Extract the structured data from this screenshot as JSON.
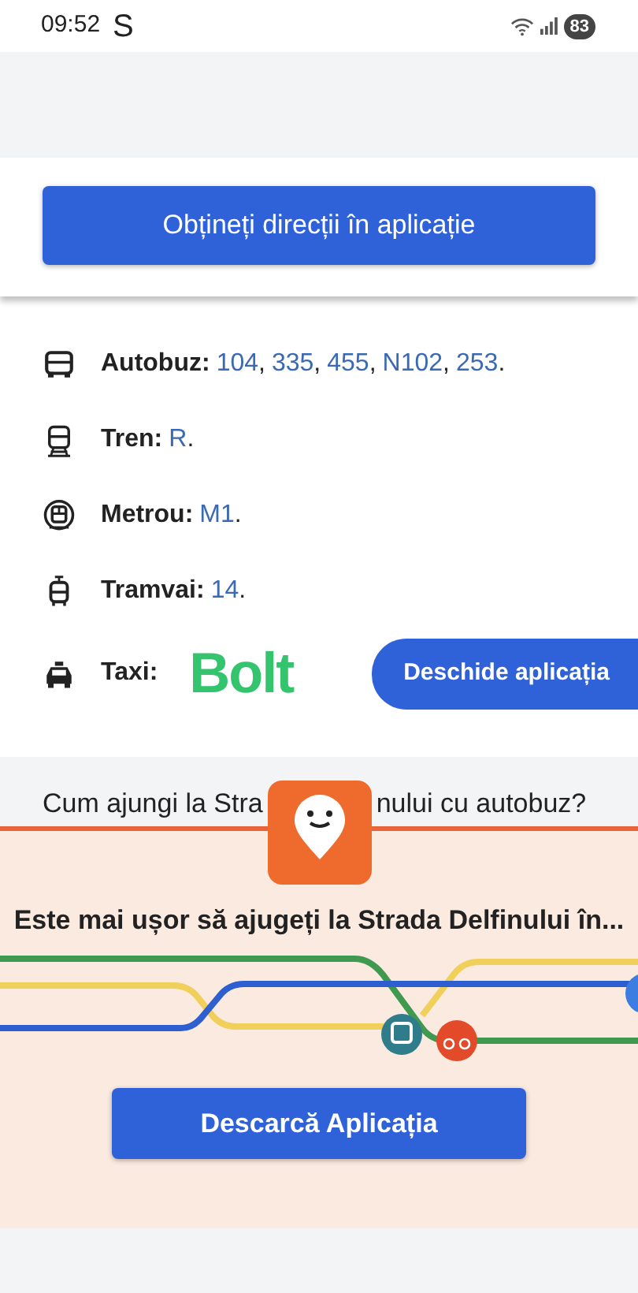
{
  "status_bar": {
    "time": "09:52",
    "notification": "S",
    "battery": "83"
  },
  "header": {
    "button": "Obțineți direcții în aplicație"
  },
  "transit": [
    {
      "kind": "bus",
      "label": "Autobuz:",
      "lines": [
        {
          "line": "104",
          "punct": ","
        },
        {
          "line": "335",
          "punct": ","
        },
        {
          "line": "455",
          "punct": ","
        },
        {
          "line": "N102",
          "punct": ","
        },
        {
          "line": "253",
          "punct": "."
        }
      ]
    },
    {
      "kind": "train",
      "label": "Tren:",
      "lines": [
        {
          "line": "R",
          "punct": "."
        }
      ]
    },
    {
      "kind": "metro",
      "label": "Metrou:",
      "lines": [
        {
          "line": "M1",
          "punct": "."
        }
      ]
    },
    {
      "kind": "tram",
      "label": "Tramvai:",
      "lines": [
        {
          "line": "14",
          "punct": "."
        }
      ]
    },
    {
      "kind": "taxi",
      "label": "Taxi:",
      "brand": "Bolt",
      "button": "Deschide aplicația"
    }
  ],
  "section": {
    "heading_parts": [
      "Cum ajungi la Stra",
      "nului cu autobuz?"
    ]
  },
  "promo": {
    "text": "Este mai ușor să ajugeți la Strada Delfinului în...",
    "button": "Descarcă Aplicația"
  }
}
